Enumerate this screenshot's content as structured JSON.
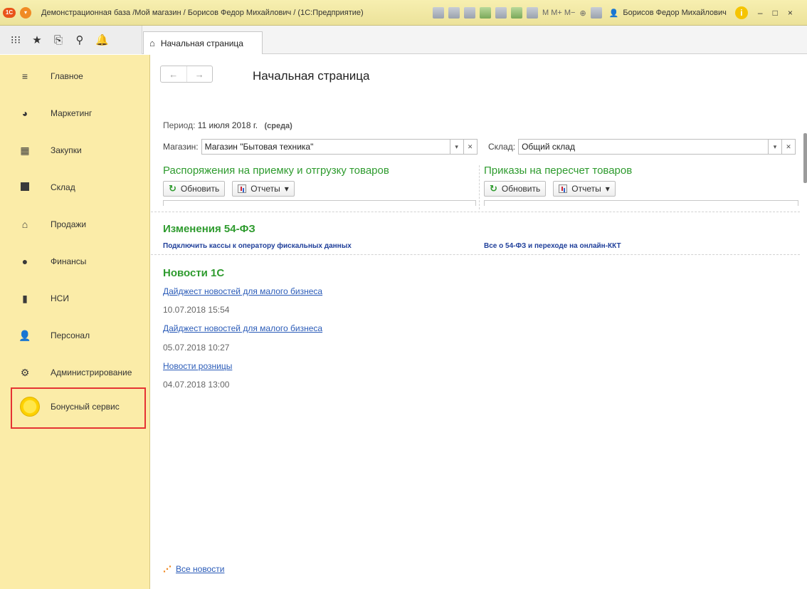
{
  "window": {
    "title": "Демонстрационная база /Мой магазин / Борисов Федор Михайлович / (1С:Предприятие)",
    "logo_text": "1С",
    "toolbar_text": "M  M+  M−",
    "user_name": "Борисов Федор Михайлович",
    "info_icon": "i",
    "minimize": "–",
    "maximize": "□",
    "close": "×"
  },
  "tab": {
    "label": "Начальная страница"
  },
  "sidebar": {
    "items": [
      {
        "label": "Главное",
        "icon": "menu-icon"
      },
      {
        "label": "Маркетинг",
        "icon": "pie-chart-icon"
      },
      {
        "label": "Закупки",
        "icon": "cart-icon"
      },
      {
        "label": "Склад",
        "icon": "warehouse-icon"
      },
      {
        "label": "Продажи",
        "icon": "basket-icon"
      },
      {
        "label": "Финансы",
        "icon": "coin-icon"
      },
      {
        "label": "НСИ",
        "icon": "book-icon"
      },
      {
        "label": "Персонал",
        "icon": "person-icon"
      },
      {
        "label": "Администрирование",
        "icon": "gear-icon"
      },
      {
        "label": "Бонусный сервис",
        "icon": "bonus-circle-icon"
      }
    ]
  },
  "content": {
    "page_title": "Начальная страница",
    "nav_back": "←",
    "nav_forward": "→",
    "period_label": "Период:",
    "period_value": "11 июля 2018 г.",
    "period_dow": "(среда)",
    "store_label": "Магазин:",
    "store_value": "Магазин \"Бытовая техника\"",
    "warehouse_label": "Склад:",
    "warehouse_value": "Общий склад",
    "left_panel": {
      "title": "Распоряжения на приемку и отгрузку товаров",
      "refresh": "Обновить",
      "reports": "Отчеты"
    },
    "right_panel": {
      "title": "Приказы на пересчет товаров",
      "refresh": "Обновить",
      "reports": "Отчеты"
    },
    "fz54": {
      "title": "Изменения 54-ФЗ",
      "link1": "Подключить кассы к оператору фискальных данных",
      "link2": "Все о 54-ФЗ и переходе на онлайн-ККТ"
    },
    "news": {
      "title": "Новости 1С",
      "items": [
        {
          "title": "Дайджест новостей для малого бизнеса",
          "date": "10.07.2018 15:54"
        },
        {
          "title": "Дайджест новостей для малого бизнеса",
          "date": "05.07.2018 10:27"
        },
        {
          "title": "Новости розницы",
          "date": "04.07.2018 13:00"
        }
      ],
      "all_news": "Все новости"
    }
  },
  "colors": {
    "sidebar_bg": "#fbeca8",
    "section_green": "#2e9b2e",
    "link_blue": "#2a5bb8",
    "highlight_red": "#e53333"
  }
}
